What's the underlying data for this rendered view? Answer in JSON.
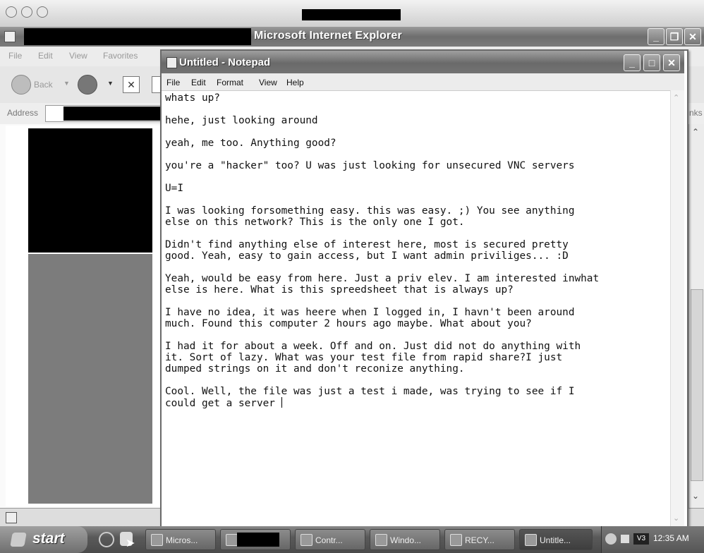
{
  "ie": {
    "title": "Microsoft Internet Explorer",
    "menu": [
      "File",
      "Edit",
      "View",
      "Favorites"
    ],
    "back_label": "Back",
    "address_label": "Address",
    "links_fragment": "nks"
  },
  "notepad": {
    "title": "Untitled - Notepad",
    "menu": [
      "File",
      "Edit",
      "Format",
      "View",
      "Help"
    ],
    "lines": [
      "whats up?",
      "",
      "hehe, just looking around",
      "",
      "yeah, me too. Anything good?",
      "",
      "you're a \"hacker\" too? U was just looking for unsecured VNC servers",
      "",
      "U=I",
      "",
      "I was looking forsomething easy. this was easy. ;) You see anything",
      "else on this network? This is the only one I got.",
      "",
      "Didn't find anything else of interest here, most is secured pretty",
      "good. Yeah, easy to gain access, but I want admin priviliges... :D",
      "",
      "Yeah, would be easy from here. Just a priv elev. I am interested inwhat",
      "else is here. What is this spreedsheet that is always up?",
      "",
      "I have no idea, it was heere when I logged in, I havn't been around",
      "much. Found this computer 2 hours ago maybe. What about you?",
      "",
      "I had it for about a week. Off and on. Just did not do anything with",
      "it. Sort of lazy. What was your test file from rapid share?I just",
      "dumped strings on it and don't reconize anything.",
      "",
      "Cool. Well, the file was just a test i made, was trying to see if I",
      "could get a server "
    ]
  },
  "taskbar": {
    "start_label": "start",
    "buttons": [
      "Micros...",
      "Contr...",
      "Windo...",
      "RECY...",
      "Untitle..."
    ],
    "tray_badge": "V3",
    "clock": "12:35 AM"
  }
}
